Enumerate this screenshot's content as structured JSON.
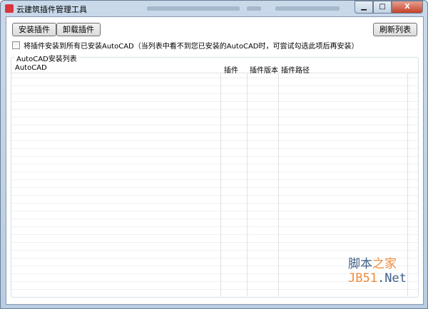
{
  "window": {
    "title": "云建筑插件管理工具",
    "controls": {
      "minimize": "▁",
      "maximize": "□",
      "close": "X"
    }
  },
  "toolbar": {
    "install": "安装插件",
    "uninstall": "卸载插件",
    "refresh": "刷新列表"
  },
  "option": {
    "label": "将插件安装到所有已安装AutoCAD（当列表中看不到您已安装的AutoCAD时，可尝试勾选此项后再安装）",
    "checked": false
  },
  "group": {
    "title": "AutoCAD安装列表"
  },
  "table": {
    "columns": [
      "AutoCAD",
      "插件",
      "插件版本",
      "插件路径"
    ],
    "rows": []
  },
  "watermark": {
    "line1a": "脚本",
    "line1b": "之家",
    "line2a": "JB51",
    "line2b": ".Net"
  }
}
